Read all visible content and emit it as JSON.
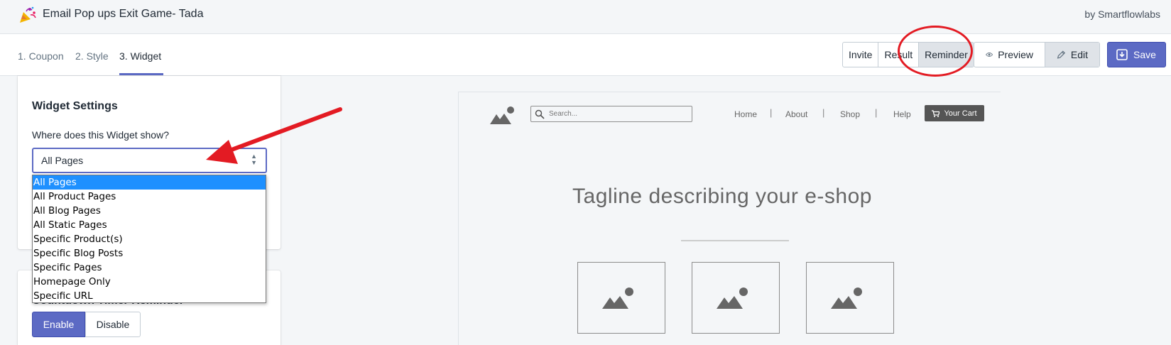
{
  "app": {
    "title": "Email Pop ups Exit Game- Tada",
    "by": "by Smartflowlabs",
    "icon": "party-popper-icon"
  },
  "tabs": [
    {
      "label": "1. Coupon",
      "active": false
    },
    {
      "label": "2. Style",
      "active": false
    },
    {
      "label": "3. Widget",
      "active": true
    }
  ],
  "view_segments": [
    {
      "label": "Invite",
      "selected": false
    },
    {
      "label": "Result",
      "selected": false
    },
    {
      "label": "Reminder",
      "selected": true
    }
  ],
  "toolbar": {
    "preview_label": "Preview",
    "edit_label": "Edit",
    "save_label": "Save"
  },
  "widget_settings": {
    "title": "Widget Settings",
    "field_label": "Where does this Widget show?",
    "selected_value": "All Pages",
    "options": [
      "All Pages",
      "All Product Pages",
      "All Blog Pages",
      "All Static Pages",
      "Specific Product(s)",
      "Specific Blog Posts",
      "Specific Pages",
      "Homepage Only",
      "Specific URL"
    ]
  },
  "countdown": {
    "title": "Countdown Timer Reminder",
    "enable_label": "Enable",
    "disable_label": "Disable"
  },
  "preview": {
    "search_placeholder": "Search...",
    "nav": [
      "Home",
      "About",
      "Shop",
      "Help"
    ],
    "cart_label": "Your Cart",
    "tagline": "Tagline describing your e-shop"
  },
  "colors": {
    "accent": "#5c6ac4",
    "annotation": "#e31b23",
    "dropdown_highlight": "#1e90ff"
  }
}
